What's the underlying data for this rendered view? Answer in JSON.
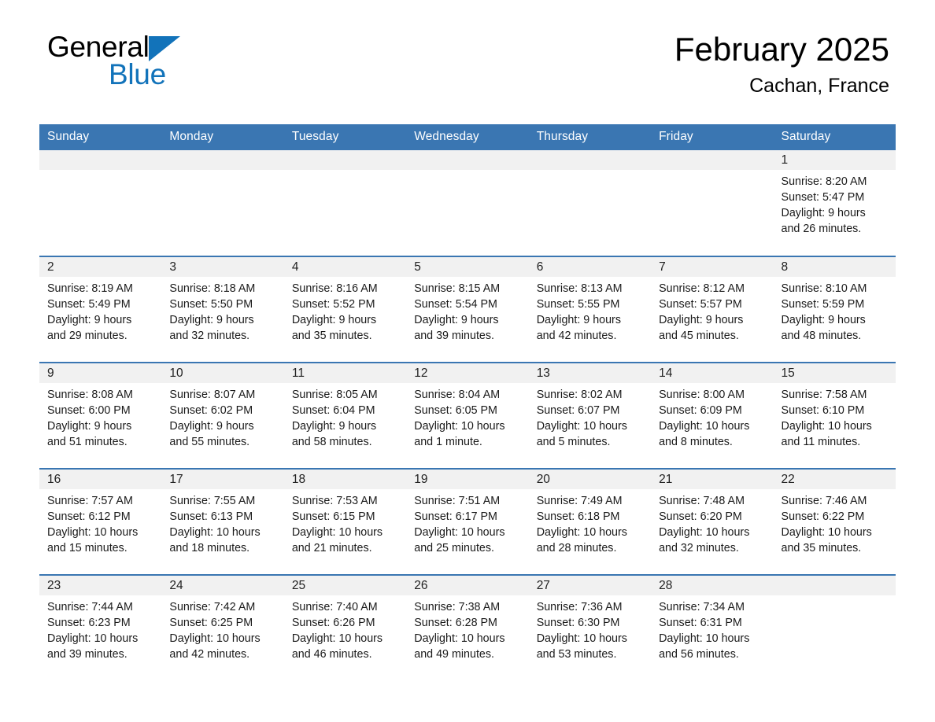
{
  "logo": {
    "word1": "General",
    "word2": "Blue",
    "triangle_color": "#1273ba"
  },
  "header": {
    "title": "February 2025",
    "subtitle": "Cachan, France"
  },
  "theme": {
    "header_blue": "#3a76b2",
    "daynum_band": "#f1f1f1",
    "text": "#1a1a1a"
  },
  "weekday_headers": [
    "Sunday",
    "Monday",
    "Tuesday",
    "Wednesday",
    "Thursday",
    "Friday",
    "Saturday"
  ],
  "weeks": [
    [
      {
        "day": "",
        "lines": []
      },
      {
        "day": "",
        "lines": []
      },
      {
        "day": "",
        "lines": []
      },
      {
        "day": "",
        "lines": []
      },
      {
        "day": "",
        "lines": []
      },
      {
        "day": "",
        "lines": []
      },
      {
        "day": "1",
        "lines": [
          "Sunrise: 8:20 AM",
          "Sunset: 5:47 PM",
          "Daylight: 9 hours",
          "and 26 minutes."
        ]
      }
    ],
    [
      {
        "day": "2",
        "lines": [
          "Sunrise: 8:19 AM",
          "Sunset: 5:49 PM",
          "Daylight: 9 hours",
          "and 29 minutes."
        ]
      },
      {
        "day": "3",
        "lines": [
          "Sunrise: 8:18 AM",
          "Sunset: 5:50 PM",
          "Daylight: 9 hours",
          "and 32 minutes."
        ]
      },
      {
        "day": "4",
        "lines": [
          "Sunrise: 8:16 AM",
          "Sunset: 5:52 PM",
          "Daylight: 9 hours",
          "and 35 minutes."
        ]
      },
      {
        "day": "5",
        "lines": [
          "Sunrise: 8:15 AM",
          "Sunset: 5:54 PM",
          "Daylight: 9 hours",
          "and 39 minutes."
        ]
      },
      {
        "day": "6",
        "lines": [
          "Sunrise: 8:13 AM",
          "Sunset: 5:55 PM",
          "Daylight: 9 hours",
          "and 42 minutes."
        ]
      },
      {
        "day": "7",
        "lines": [
          "Sunrise: 8:12 AM",
          "Sunset: 5:57 PM",
          "Daylight: 9 hours",
          "and 45 minutes."
        ]
      },
      {
        "day": "8",
        "lines": [
          "Sunrise: 8:10 AM",
          "Sunset: 5:59 PM",
          "Daylight: 9 hours",
          "and 48 minutes."
        ]
      }
    ],
    [
      {
        "day": "9",
        "lines": [
          "Sunrise: 8:08 AM",
          "Sunset: 6:00 PM",
          "Daylight: 9 hours",
          "and 51 minutes."
        ]
      },
      {
        "day": "10",
        "lines": [
          "Sunrise: 8:07 AM",
          "Sunset: 6:02 PM",
          "Daylight: 9 hours",
          "and 55 minutes."
        ]
      },
      {
        "day": "11",
        "lines": [
          "Sunrise: 8:05 AM",
          "Sunset: 6:04 PM",
          "Daylight: 9 hours",
          "and 58 minutes."
        ]
      },
      {
        "day": "12",
        "lines": [
          "Sunrise: 8:04 AM",
          "Sunset: 6:05 PM",
          "Daylight: 10 hours",
          "and 1 minute."
        ]
      },
      {
        "day": "13",
        "lines": [
          "Sunrise: 8:02 AM",
          "Sunset: 6:07 PM",
          "Daylight: 10 hours",
          "and 5 minutes."
        ]
      },
      {
        "day": "14",
        "lines": [
          "Sunrise: 8:00 AM",
          "Sunset: 6:09 PM",
          "Daylight: 10 hours",
          "and 8 minutes."
        ]
      },
      {
        "day": "15",
        "lines": [
          "Sunrise: 7:58 AM",
          "Sunset: 6:10 PM",
          "Daylight: 10 hours",
          "and 11 minutes."
        ]
      }
    ],
    [
      {
        "day": "16",
        "lines": [
          "Sunrise: 7:57 AM",
          "Sunset: 6:12 PM",
          "Daylight: 10 hours",
          "and 15 minutes."
        ]
      },
      {
        "day": "17",
        "lines": [
          "Sunrise: 7:55 AM",
          "Sunset: 6:13 PM",
          "Daylight: 10 hours",
          "and 18 minutes."
        ]
      },
      {
        "day": "18",
        "lines": [
          "Sunrise: 7:53 AM",
          "Sunset: 6:15 PM",
          "Daylight: 10 hours",
          "and 21 minutes."
        ]
      },
      {
        "day": "19",
        "lines": [
          "Sunrise: 7:51 AM",
          "Sunset: 6:17 PM",
          "Daylight: 10 hours",
          "and 25 minutes."
        ]
      },
      {
        "day": "20",
        "lines": [
          "Sunrise: 7:49 AM",
          "Sunset: 6:18 PM",
          "Daylight: 10 hours",
          "and 28 minutes."
        ]
      },
      {
        "day": "21",
        "lines": [
          "Sunrise: 7:48 AM",
          "Sunset: 6:20 PM",
          "Daylight: 10 hours",
          "and 32 minutes."
        ]
      },
      {
        "day": "22",
        "lines": [
          "Sunrise: 7:46 AM",
          "Sunset: 6:22 PM",
          "Daylight: 10 hours",
          "and 35 minutes."
        ]
      }
    ],
    [
      {
        "day": "23",
        "lines": [
          "Sunrise: 7:44 AM",
          "Sunset: 6:23 PM",
          "Daylight: 10 hours",
          "and 39 minutes."
        ]
      },
      {
        "day": "24",
        "lines": [
          "Sunrise: 7:42 AM",
          "Sunset: 6:25 PM",
          "Daylight: 10 hours",
          "and 42 minutes."
        ]
      },
      {
        "day": "25",
        "lines": [
          "Sunrise: 7:40 AM",
          "Sunset: 6:26 PM",
          "Daylight: 10 hours",
          "and 46 minutes."
        ]
      },
      {
        "day": "26",
        "lines": [
          "Sunrise: 7:38 AM",
          "Sunset: 6:28 PM",
          "Daylight: 10 hours",
          "and 49 minutes."
        ]
      },
      {
        "day": "27",
        "lines": [
          "Sunrise: 7:36 AM",
          "Sunset: 6:30 PM",
          "Daylight: 10 hours",
          "and 53 minutes."
        ]
      },
      {
        "day": "28",
        "lines": [
          "Sunrise: 7:34 AM",
          "Sunset: 6:31 PM",
          "Daylight: 10 hours",
          "and 56 minutes."
        ]
      },
      {
        "day": "",
        "lines": []
      }
    ]
  ]
}
